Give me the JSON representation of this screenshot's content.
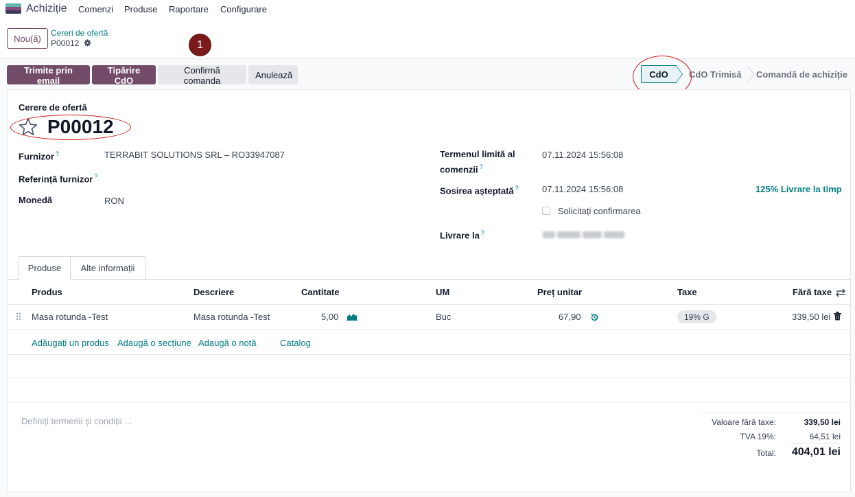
{
  "navbar": {
    "app_name": "Achiziție",
    "menu": [
      "Comenzi",
      "Produse",
      "Raportare",
      "Configurare"
    ]
  },
  "control_panel": {
    "new_button": "Nou(ă)",
    "breadcrumb_parent": "Cereri de ofertă",
    "breadcrumb_current": "P00012",
    "step_badge": "1"
  },
  "actions": {
    "send_email": "Trimite prin email",
    "print": "Tipărire CdO",
    "confirm": "Confirmă comanda",
    "cancel": "Anulează"
  },
  "status": {
    "steps": [
      "CdO",
      "CdO Trimisă",
      "Comandă de achiziție"
    ],
    "active": "CdO"
  },
  "form": {
    "doc_type": "Cerere de ofertă",
    "doc_number": "P00012",
    "vendor_label": "Furnizor",
    "vendor_value": "TERRABIT SOLUTIONS SRL – RO33947087",
    "vendor_ref_label": "Referință furnizor",
    "currency_label": "Monedă",
    "currency_value": "RON",
    "deadline_label_1": "Termenul limită al",
    "deadline_label_2": "comenzii",
    "deadline_value": "07.11.2024 15:56:08",
    "expected_label": "Sosirea așteptată",
    "expected_value": "07.11.2024 15:56:08",
    "on_time": "125% Livrare la timp",
    "ask_confirm": "Solicitați confirmarea",
    "deliver_to_label": "Livrare la",
    "help_mark": "?"
  },
  "tabs": [
    "Produse",
    "Alte informații"
  ],
  "table": {
    "headers": {
      "product": "Produs",
      "description": "Descriere",
      "qty": "Cantitate",
      "uom": "UM",
      "price": "Preț unitar",
      "taxes": "Taxe",
      "subtotal": "Fără taxe"
    },
    "rows": [
      {
        "product": "Masa rotunda -Test",
        "description": "Masa rotunda -Test",
        "qty": "5,00",
        "uom": "Buc",
        "price": "67,90",
        "tax": "19% G",
        "subtotal": "339,50 lei"
      }
    ],
    "links": [
      "Adăugați un produs",
      "Adaugă o secțiune",
      "Adaugă o notă",
      "Catalog"
    ]
  },
  "footer": {
    "terms_placeholder": "Definiți termenii și condiții ...",
    "untaxed_label": "Valoare fără taxe:",
    "untaxed_value": "339,50 lei",
    "vat_label": "TVA 19%:",
    "vat_value": "64,51 lei",
    "total_label": "Total:",
    "total_value": "404,01 lei"
  },
  "colors": {
    "primary": "#714b67",
    "teal": "#017e84",
    "annotation_red": "#d01818"
  }
}
